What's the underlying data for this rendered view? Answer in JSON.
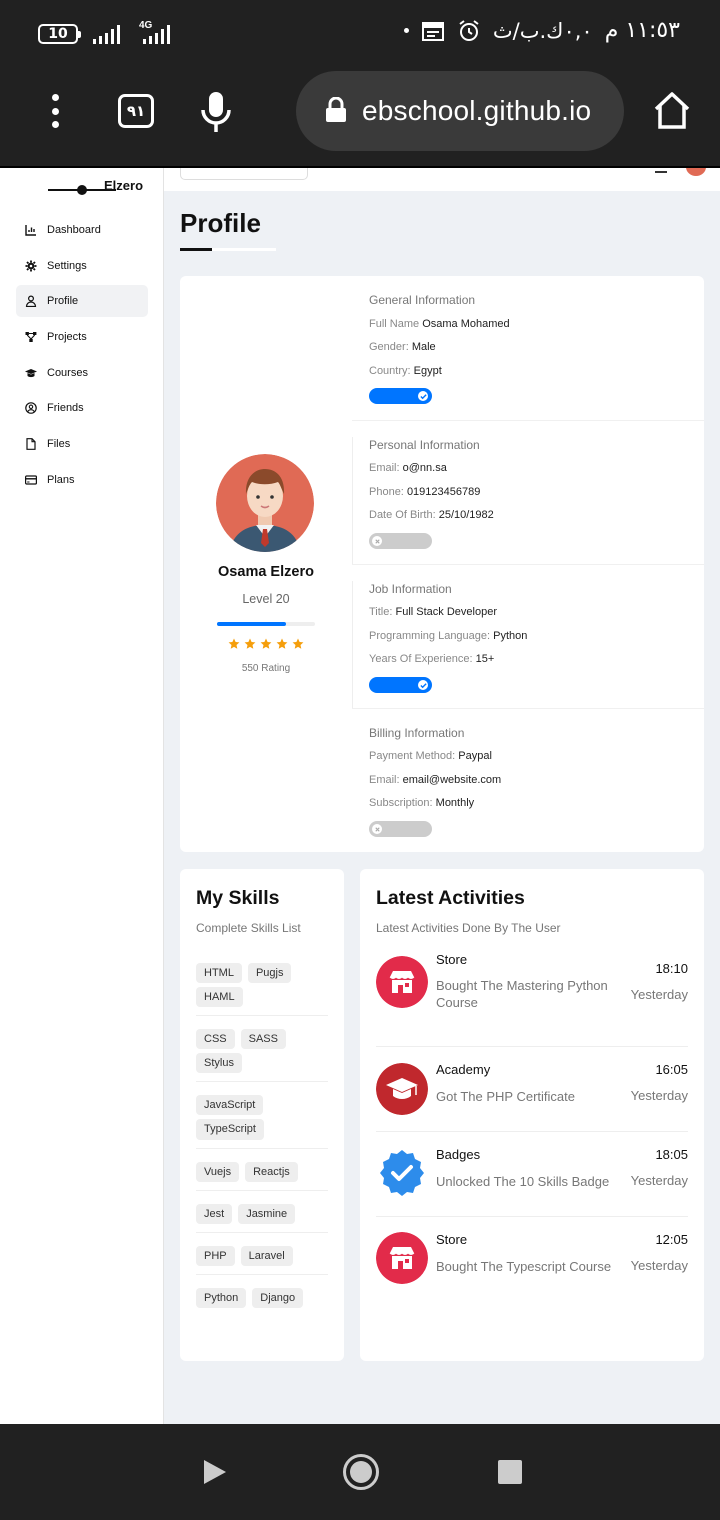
{
  "status_bar": {
    "battery_level": "10",
    "network_type": "4G",
    "time": "١١:٥٣ م",
    "data_speed": "٠,٠ك.ب/ث"
  },
  "browser": {
    "tab_count": "٩١",
    "url": "ebschool.github.io"
  },
  "sidebar": {
    "logo_text": "Elzero",
    "items": [
      {
        "label": "Dashboard",
        "icon": "chart-icon"
      },
      {
        "label": "Settings",
        "icon": "gear-icon"
      },
      {
        "label": "Profile",
        "icon": "user-icon"
      },
      {
        "label": "Projects",
        "icon": "diagram-icon"
      },
      {
        "label": "Courses",
        "icon": "graduation-cap-icon"
      },
      {
        "label": "Friends",
        "icon": "user-circle-icon"
      },
      {
        "label": "Files",
        "icon": "file-icon"
      },
      {
        "label": "Plans",
        "icon": "credit-card-icon"
      }
    ]
  },
  "page": {
    "title": "Profile"
  },
  "profile": {
    "name": "Osama Elzero",
    "level": "Level 20",
    "level_progress": 0.7,
    "stars": 5,
    "rating": "550 Rating"
  },
  "sections": {
    "general": {
      "heading": "General Information",
      "rows": [
        {
          "label": "Full Name",
          "value": "Osama Mohamed"
        },
        {
          "label": "Gender:",
          "value": "Male"
        },
        {
          "label": "Country:",
          "value": "Egypt"
        }
      ],
      "toggle_on": true
    },
    "personal": {
      "heading": "Personal Information",
      "rows": [
        {
          "label": "Email:",
          "value": "o@nn.sa"
        },
        {
          "label": "Phone:",
          "value": "019123456789"
        },
        {
          "label": "Date Of Birth:",
          "value": "25/10/1982"
        }
      ],
      "toggle_on": false
    },
    "job": {
      "heading": "Job Information",
      "rows": [
        {
          "label": "Title:",
          "value": "Full Stack Developer"
        },
        {
          "label": "Programming Language:",
          "value": "Python"
        },
        {
          "label": "Years Of Experience:",
          "value": "15+"
        }
      ],
      "toggle_on": true
    },
    "billing": {
      "heading": "Billing Information",
      "rows": [
        {
          "label": "Payment Method:",
          "value": "Paypal"
        },
        {
          "label": "Email:",
          "value": "email@website.com"
        },
        {
          "label": "Subscription:",
          "value": "Monthly"
        }
      ],
      "toggle_on": false
    }
  },
  "skills": {
    "title": "My Skills",
    "subtitle": "Complete Skills List",
    "groups": [
      [
        "HTML",
        "Pugjs",
        "HAML"
      ],
      [
        "CSS",
        "SASS",
        "Stylus"
      ],
      [
        "JavaScript",
        "TypeScript"
      ],
      [
        "Vuejs",
        "Reactjs"
      ],
      [
        "Jest",
        "Jasmine"
      ],
      [
        "PHP",
        "Laravel"
      ],
      [
        "Python",
        "Django"
      ]
    ]
  },
  "activities": {
    "title": "Latest Activities",
    "subtitle": "Latest Activities Done By The User",
    "items": [
      {
        "title": "Store",
        "desc": "Bought The Mastering Python Course",
        "time": "18:10",
        "day": "Yesterday",
        "icon": "store-icon"
      },
      {
        "title": "Academy",
        "desc": "Got The PHP Certificate",
        "time": "16:05",
        "day": "Yesterday",
        "icon": "graduation-cap-icon"
      },
      {
        "title": "Badges",
        "desc": "Unlocked The 10 Skills Badge",
        "time": "18:05",
        "day": "Yesterday",
        "icon": "badge-check-icon"
      },
      {
        "title": "Store",
        "desc": "Bought The Typescript Course",
        "time": "12:05",
        "day": "Yesterday",
        "icon": "store-icon"
      }
    ]
  },
  "colors": {
    "accent": "#0075ff",
    "star": "#f59e0b",
    "store_red": "#e22b4a",
    "academy_red": "#c0282d",
    "badge_blue": "#2d8ceb"
  }
}
